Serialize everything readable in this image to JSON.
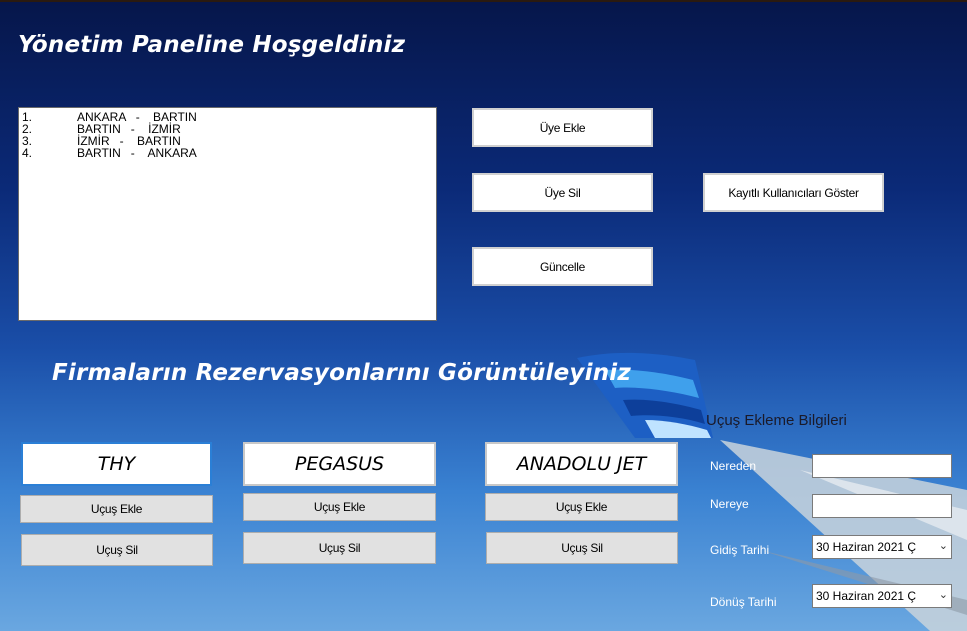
{
  "header": {
    "title": "Yönetim Paneline Hoşgeldiniz"
  },
  "routes": [
    {
      "num": "1.",
      "text": "ANKARA   -    BARTIN"
    },
    {
      "num": "2.",
      "text": "BARTIN   -    İZMİR"
    },
    {
      "num": "3.",
      "text": "İZMİR   -    BARTIN"
    },
    {
      "num": "4.",
      "text": "BARTIN   -    ANKARA"
    }
  ],
  "member_buttons": {
    "add": "Üye Ekle",
    "delete": "Üye Sil",
    "update": "Güncelle",
    "show_users": "Kayıtlı Kullanıcıları Göster"
  },
  "reservations": {
    "title": "Firmaların Rezervasyonlarını Görüntüleyiniz"
  },
  "companies": [
    {
      "name": "THY",
      "add_flight": "Uçuş Ekle",
      "delete_flight": "Uçuş Sil"
    },
    {
      "name": "PEGASUS",
      "add_flight": "Uçuş Ekle",
      "delete_flight": "Uçuş Sil"
    },
    {
      "name": "ANADOLU JET",
      "add_flight": "Uçuş Ekle",
      "delete_flight": "Uçuş Sil"
    }
  ],
  "flight_form": {
    "title": "Uçuş Ekleme Bilgileri",
    "from_label": "Nereden",
    "from_value": "",
    "to_label": "Nereye",
    "to_value": "",
    "departure_label": "Gidiş Tarihi",
    "departure_value": "30  Haziran  2021 Ç",
    "return_label": "Dönüş Tarihi",
    "return_value": "30  Haziran  2021 Ç"
  },
  "colors": {
    "background_top": "#06164a",
    "background_bottom": "#6aa7e0",
    "active_border": "#2a7fd6"
  }
}
